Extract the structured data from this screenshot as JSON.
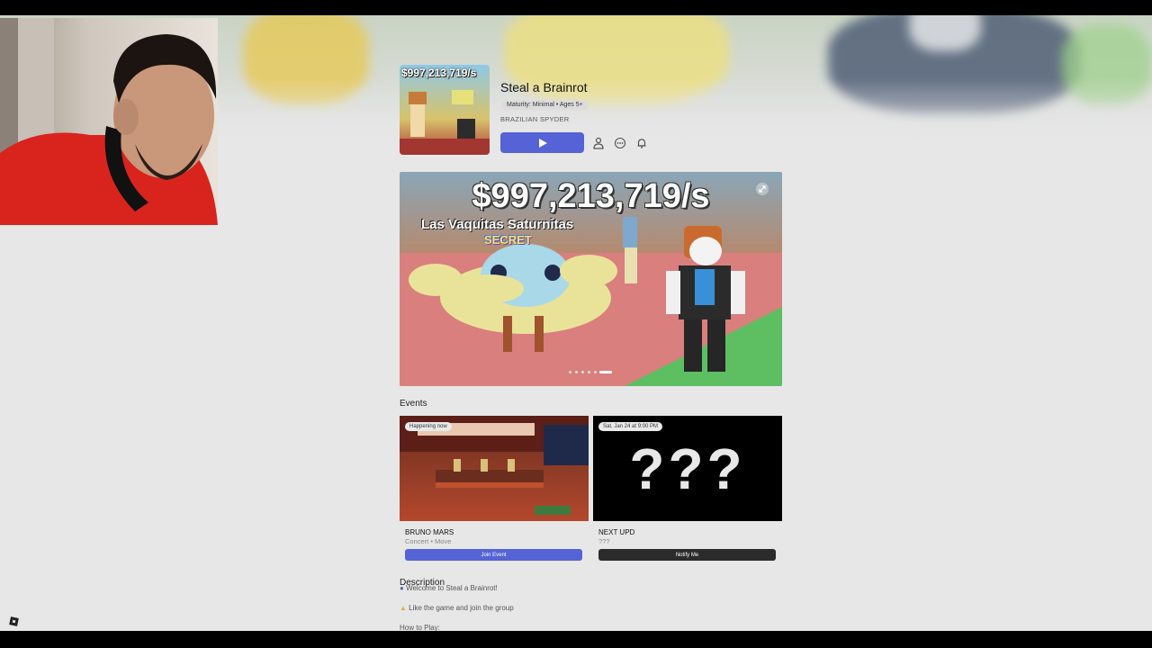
{
  "game": {
    "title": "Steal a Brainrot",
    "maturity": "Maturity: Minimal • Ages 5+",
    "creator": "BRAZILIAN SPYDER",
    "thumbnail_price": "$997,213,719/s",
    "accent_color": "#5563d6"
  },
  "header_actions": {
    "play_icon": "play-icon",
    "icons": [
      "avatar-icon",
      "more-icon",
      "bell-icon"
    ]
  },
  "carousel": {
    "price_text": "$997,213,719/s",
    "character_name": "Las Vaquitas Saturnitas",
    "rarity": "SECRET",
    "slide_count": 6,
    "active_slide": 6
  },
  "events": {
    "heading": "Events",
    "items": [
      {
        "chip": "Happening now",
        "name": "BRUNO MARS",
        "subtitle": "Concert • Move",
        "button": "Join Event",
        "button_color": "#5563d6"
      },
      {
        "chip": "Sat, Jan 24 at 9:00 PM",
        "image_text": "???",
        "name": "NEXT UPD",
        "subtitle": "???",
        "button": "Notify Me",
        "button_color": "#2b2b2b"
      }
    ]
  },
  "description": {
    "heading": "Description",
    "lines": [
      "Welcome to Steal a Brainrot!",
      "Like the game and join the group",
      "How to Play:"
    ]
  }
}
